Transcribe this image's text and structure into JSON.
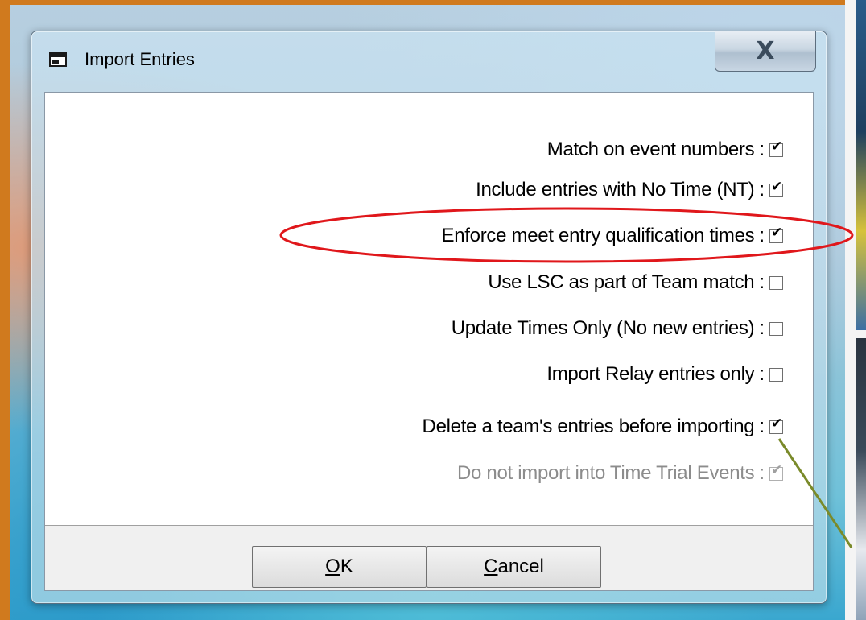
{
  "window": {
    "title": "Import Entries",
    "close_label": "X"
  },
  "options": [
    {
      "label": "Match on event numbers",
      "checked": true,
      "enabled": true
    },
    {
      "label": "Include entries with No Time (NT)",
      "checked": true,
      "enabled": true
    },
    {
      "label": "Enforce meet entry qualification times",
      "checked": true,
      "enabled": true
    },
    {
      "label": "Use LSC as part of Team match",
      "checked": false,
      "enabled": true
    },
    {
      "label": "Update Times Only (No new entries)",
      "checked": false,
      "enabled": true
    },
    {
      "label": "Import Relay entries only",
      "checked": false,
      "enabled": true
    },
    {
      "label": "Delete a team's entries before importing",
      "checked": true,
      "enabled": true
    },
    {
      "label": "Do not import into Time Trial Events",
      "checked": true,
      "enabled": false
    }
  ],
  "separator": ":",
  "buttons": {
    "ok_mnemonic": "O",
    "ok_rest": "K",
    "cancel_mnemonic": "C",
    "cancel_rest": "ancel"
  },
  "annotation": {
    "highlight_color": "#e0171b",
    "arrow_color": "#7a8a2a",
    "highlighted_option_index": 2
  },
  "colors": {
    "checkbox_mark": "#000000",
    "disabled_text": "#8c8c8c"
  }
}
